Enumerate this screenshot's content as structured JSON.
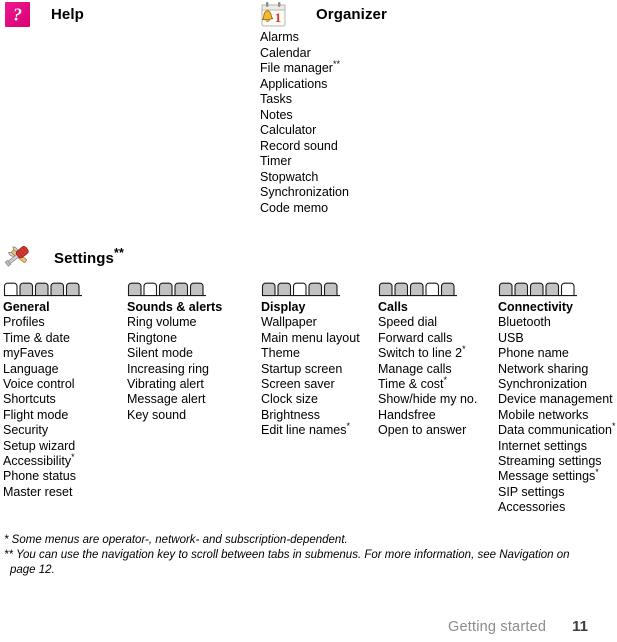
{
  "sections": {
    "help": {
      "title": "Help",
      "icon": "help-question-icon",
      "icon_color": "#e5007e",
      "items": []
    },
    "organizer": {
      "title": "Organizer",
      "icon": "calendar-alarm-icon",
      "items": [
        "Alarms",
        "Calendar",
        "File manager**",
        "Applications",
        "Tasks",
        "Notes",
        "Calculator",
        "Record sound",
        "Timer",
        "Stopwatch",
        "Synchronization",
        "Code memo"
      ]
    },
    "settings": {
      "title": "Settings**",
      "icon": "wrench-screwdriver-icon",
      "columns": [
        {
          "title": "General",
          "tabs_total": 5,
          "tab_selected": 1,
          "items": [
            "Profiles",
            "Time & date",
            "myFaves",
            "Language",
            "Voice control",
            "Shortcuts",
            "Flight mode",
            "Security",
            "Setup wizard",
            "Accessibility*",
            "Phone status",
            "Master reset"
          ]
        },
        {
          "title": "Sounds & alerts",
          "tabs_total": 5,
          "tab_selected": 2,
          "items": [
            "Ring volume",
            "Ringtone",
            "Silent mode",
            "Increasing ring",
            "Vibrating alert",
            "Message alert",
            "Key sound"
          ]
        },
        {
          "title": "Display",
          "tabs_total": 5,
          "tab_selected": 3,
          "items": [
            "Wallpaper",
            "Main menu layout",
            "Theme",
            "Startup screen",
            "Screen saver",
            "Clock size",
            "Brightness",
            "Edit line names*"
          ]
        },
        {
          "title": "Calls",
          "tabs_total": 5,
          "tab_selected": 4,
          "items": [
            "Speed dial",
            "Forward calls",
            "Switch to line 2*",
            "Manage calls",
            "Time & cost*",
            "Show/hide my no.",
            "Handsfree",
            "Open to answer"
          ]
        },
        {
          "title": "Connectivity",
          "tabs_total": 5,
          "tab_selected": 5,
          "items": [
            "Bluetooth",
            "USB",
            "Phone name",
            "Network sharing",
            "Synchronization",
            "Device management",
            "Mobile networks",
            "Data communication*",
            "Internet settings",
            "Streaming settings",
            "Message settings*",
            "SIP settings",
            "Accessories"
          ]
        }
      ]
    }
  },
  "footnotes": [
    "* Some menus are operator-, network- and subscription-dependent.",
    "** You can use the navigation key to scroll between tabs in submenus. For more information, see Navigation on",
    "page 12."
  ],
  "footer": {
    "section": "Getting started",
    "page_number": "11"
  }
}
